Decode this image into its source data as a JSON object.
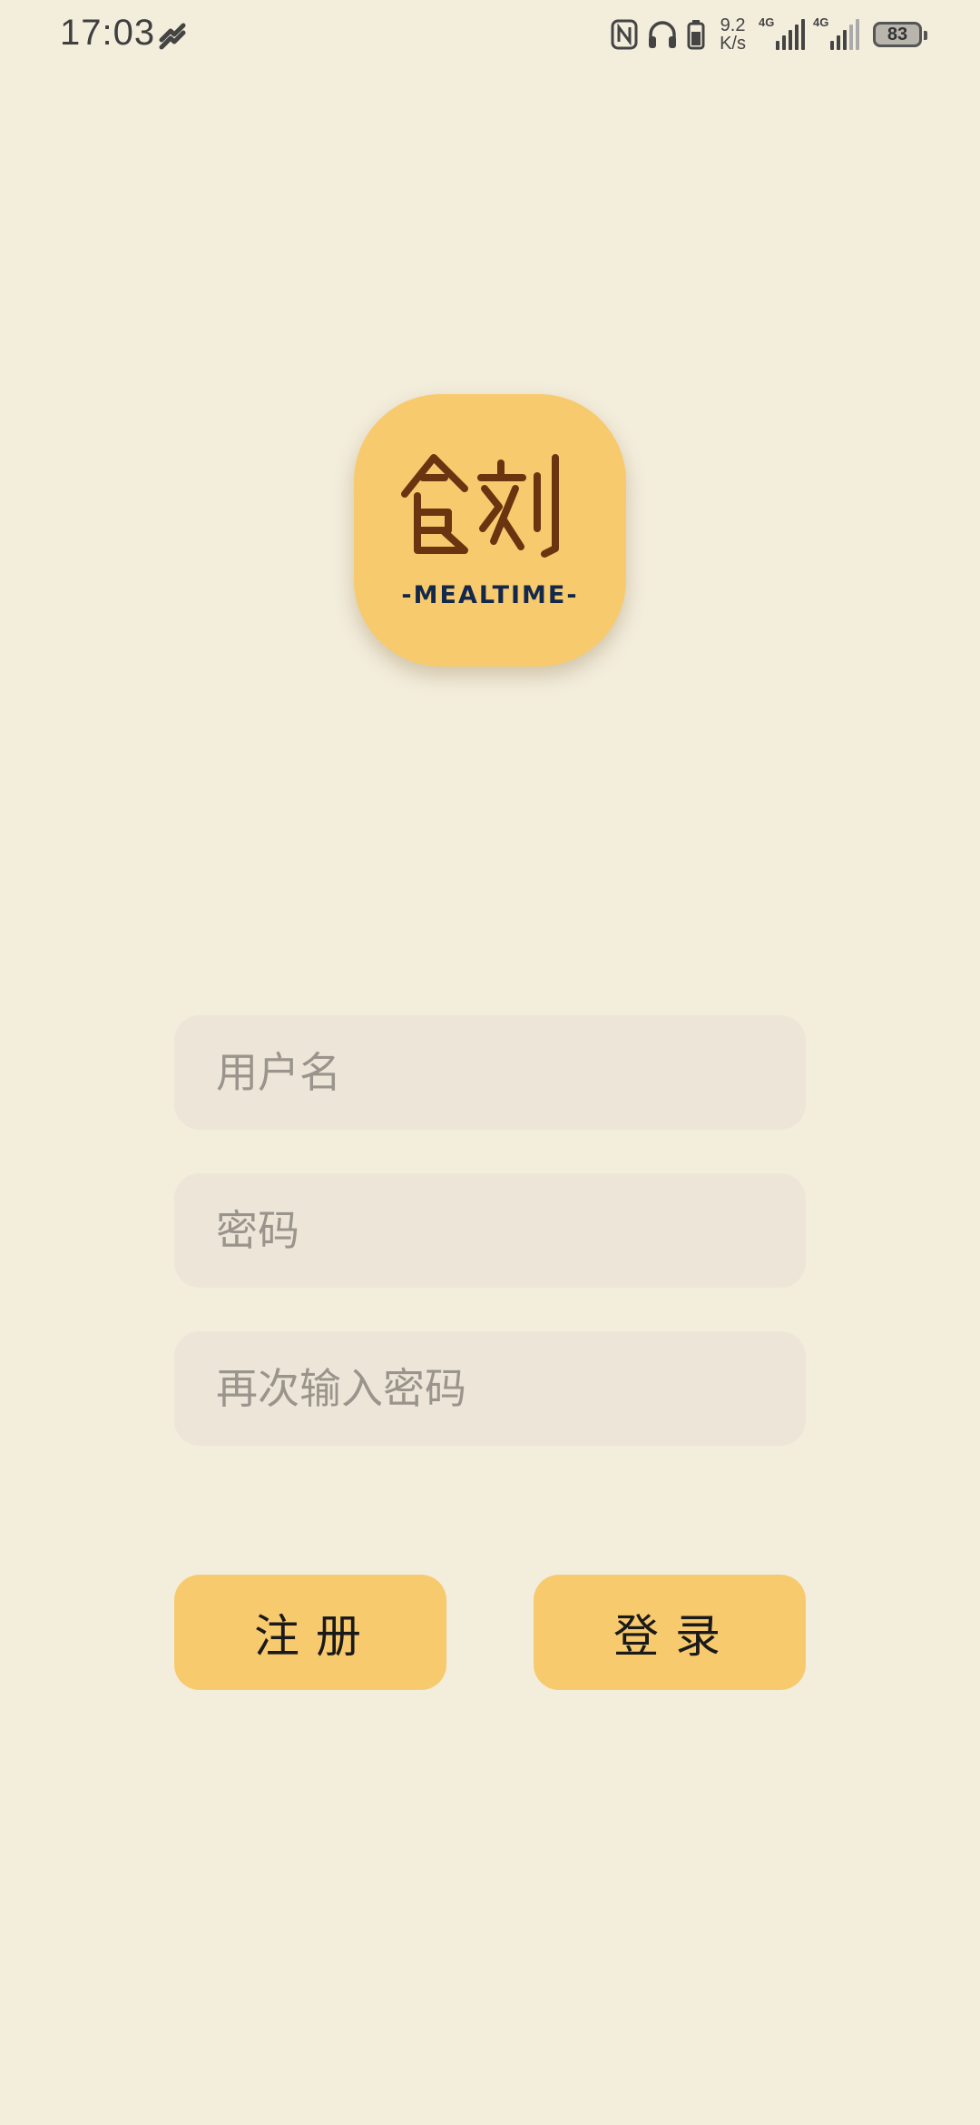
{
  "status_bar": {
    "time": "17:03",
    "net_speed_value": "9.2",
    "net_speed_unit": "K/s",
    "sim1_label": "4G",
    "sim2_label": "4G",
    "battery": "83"
  },
  "logo": {
    "title": "食刻",
    "subtitle": "-MEALTIME-"
  },
  "form": {
    "username_placeholder": "用户名",
    "password_placeholder": "密码",
    "confirm_placeholder": "再次输入密码"
  },
  "buttons": {
    "register_label": "注册",
    "login_label": "登录"
  },
  "colors": {
    "background": "#f3eddc",
    "accent": "#f8ca6e",
    "input_bg": "#ede6d8",
    "logo_brown": "#6b3410",
    "logo_navy": "#14284a"
  }
}
